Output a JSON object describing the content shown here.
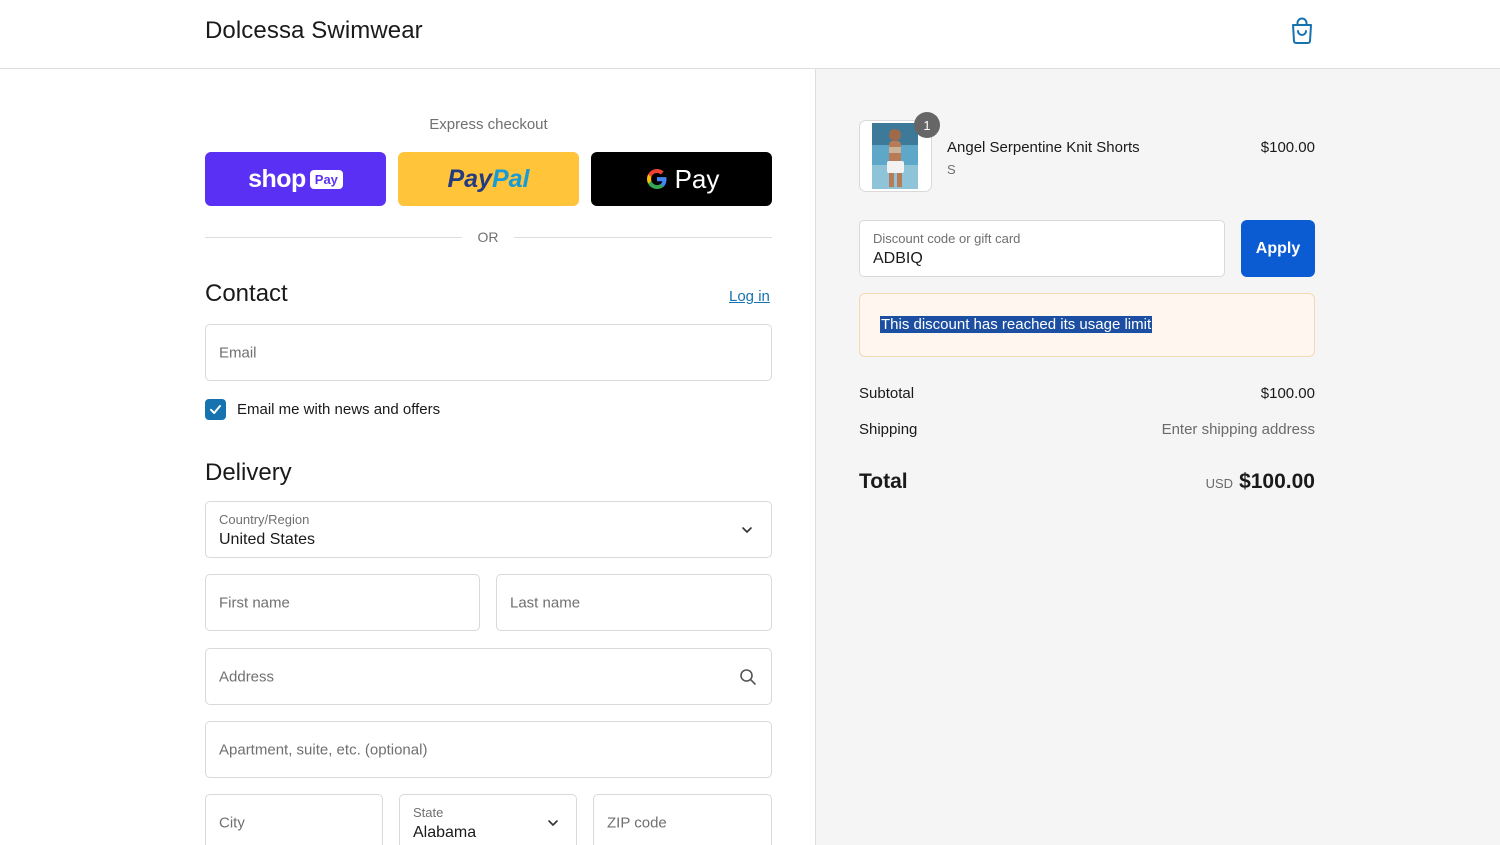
{
  "header": {
    "brand": "Dolcessa Swimwear",
    "cart_icon": "shopping-bag-icon",
    "accent_color": "#1773b0"
  },
  "express": {
    "label": "Express checkout",
    "shop_pay": {
      "word": "shop",
      "tag": "Pay",
      "color": "#5a31f4"
    },
    "paypal": {
      "word_a": "Pay",
      "word_b": "Pal",
      "color": "#ffc439"
    },
    "gpay": {
      "g": "G",
      "word": "Pay",
      "color": "#000000"
    },
    "or_text": "OR"
  },
  "contact": {
    "title": "Contact",
    "login_link": "Log in",
    "email_placeholder": "Email",
    "newsletter_label": "Email me with news and offers",
    "newsletter_checked": true
  },
  "delivery": {
    "title": "Delivery",
    "country_label": "Country/Region",
    "country_value": "United States",
    "first_name_placeholder": "First name",
    "last_name_placeholder": "Last name",
    "address_placeholder": "Address",
    "apartment_placeholder": "Apartment, suite, etc. (optional)",
    "city_placeholder": "City",
    "state_label": "State",
    "state_value": "Alabama",
    "zip_placeholder": "ZIP code"
  },
  "order": {
    "item": {
      "quantity": "1",
      "name": "Angel Serpentine Knit Shorts",
      "variant": "S",
      "price": "$100.00"
    },
    "discount": {
      "label": "Discount code or gift card",
      "value": "ADBIQ",
      "apply_label": "Apply",
      "apply_color": "#0b5bd3"
    },
    "alert_text": "This discount has reached its usage limit",
    "subtotal_label": "Subtotal",
    "subtotal_value": "$100.00",
    "shipping_label": "Shipping",
    "shipping_value": "Enter shipping address",
    "total_label": "Total",
    "total_currency": "USD",
    "total_value": "$100.00"
  }
}
